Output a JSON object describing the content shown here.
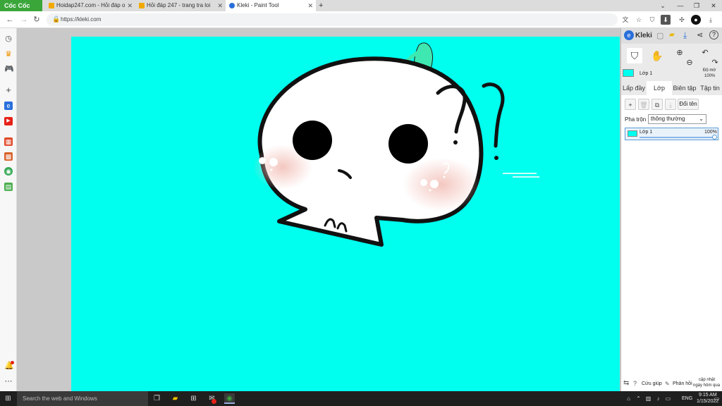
{
  "browser": {
    "brand": "Cốc Cốc",
    "tabs": [
      {
        "label": "Hoidap247.com - Hỏi đáp o",
        "favicon_color": "#f2a900"
      },
      {
        "label": "Hỏi đáp 247 - trang tra loi",
        "favicon_color": "#f2a900"
      },
      {
        "label": "Kleki - Paint Tool",
        "favicon_color": "#2a6fdb"
      }
    ],
    "new_tab": "+",
    "url": "https://kleki.com"
  },
  "kleki": {
    "app_name": "Kleki",
    "opacity_label": "Độ mờ",
    "opacity_value": "100%",
    "active_layer_name": "Lớp 1",
    "tabs": [
      "Lấp đầy",
      "Lớp",
      "Biên tập",
      "Tập tin"
    ],
    "rename_label": "Đổi tên",
    "blend_label": "Pha trộn",
    "blend_value": "thông thường",
    "layers": [
      {
        "name": "Lớp 1",
        "opacity": "100%"
      }
    ],
    "footer": {
      "help": "Cứu giúp",
      "feedback": "Phản hồi",
      "updated": "cập nhật",
      "updated_when": "ngày hôm qua"
    }
  },
  "taskbar": {
    "search_placeholder": "Search the web and Windows",
    "lang": "ENG",
    "time": "9:15 AM",
    "date": "1/15/2022"
  },
  "colors": {
    "canvas_bg": "#00ffee",
    "accent_green": "#3aa63a",
    "kleki_blue": "#2a6fdb"
  }
}
